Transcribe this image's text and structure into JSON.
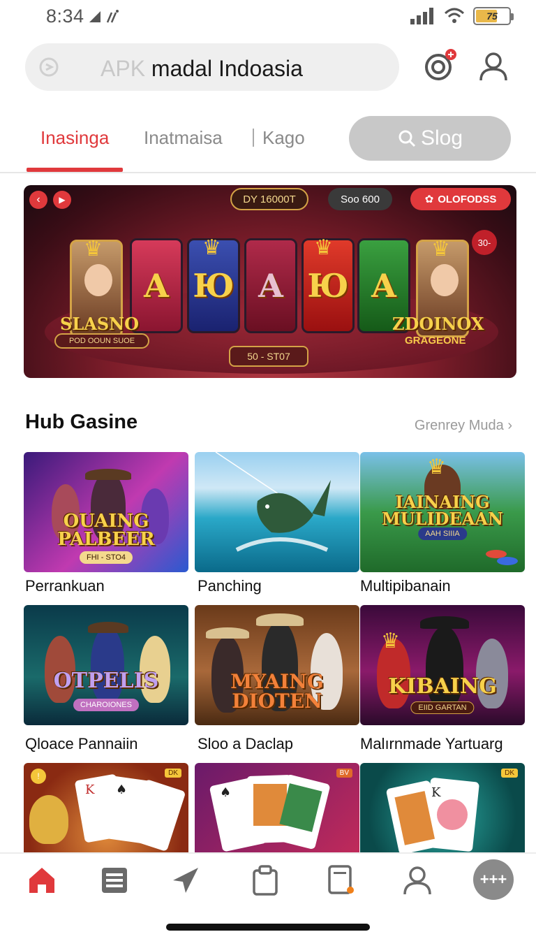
{
  "status_bar": {
    "time": "8:34",
    "battery_label": "75"
  },
  "search": {
    "prefix": "APK",
    "value": "madal Indoasia"
  },
  "tabs": [
    {
      "label": "Inasinga",
      "active": true
    },
    {
      "label": "Inatmaisa",
      "active": false
    },
    {
      "label": "Kago",
      "active": false
    }
  ],
  "slog_button": {
    "label": "Slog"
  },
  "banner": {
    "pill_dy": "DY 16000T",
    "pill_soo": "Soo 600",
    "pill_offer": "OLOFODSS",
    "reels": [
      "A",
      "Ю",
      "A",
      "Ю",
      "A"
    ],
    "title_left": "SLASNO",
    "subtitle_left": "POD OOUN SUOE",
    "title_right": "ZDOINOX",
    "subtitle_right": "GRAGEONE",
    "bottom_pill": "50 - ST07",
    "badge": "30-"
  },
  "section": {
    "title": "Hub Gasine",
    "link": "Grenrey Muda"
  },
  "games": [
    {
      "label": "Perrankuan",
      "card_title": "OUAING\nPALBEER",
      "card_sub": "FHI - STO4"
    },
    {
      "label": "Panching",
      "card_title": "",
      "card_sub": ""
    },
    {
      "label": "Multipibanain",
      "card_title": "IAINAING\nMULIDEAAN",
      "card_sub": "AAH SIIIA"
    },
    {
      "label": "Qloace Pannaiin",
      "card_title": "OTPELIS",
      "card_sub": "CHAROIONES"
    },
    {
      "label": "Sloo a Daclap",
      "card_title": "MYAING\nDIOTEN",
      "card_sub": ""
    },
    {
      "label": "Malırnmade Yartuarg",
      "card_title": "KIBAING",
      "card_sub": "EIID GARTAN"
    }
  ],
  "bottom_cards_badges": [
    "DK",
    "BV",
    "DK"
  ],
  "colors": {
    "accent": "#e0393c",
    "tab_inactive": "#8a8a8a",
    "search_bg": "#efefef"
  },
  "bottom_nav": [
    "home-icon",
    "list-icon",
    "send-icon",
    "clipboard-icon",
    "document-icon",
    "profile-icon",
    "fab-icon"
  ]
}
